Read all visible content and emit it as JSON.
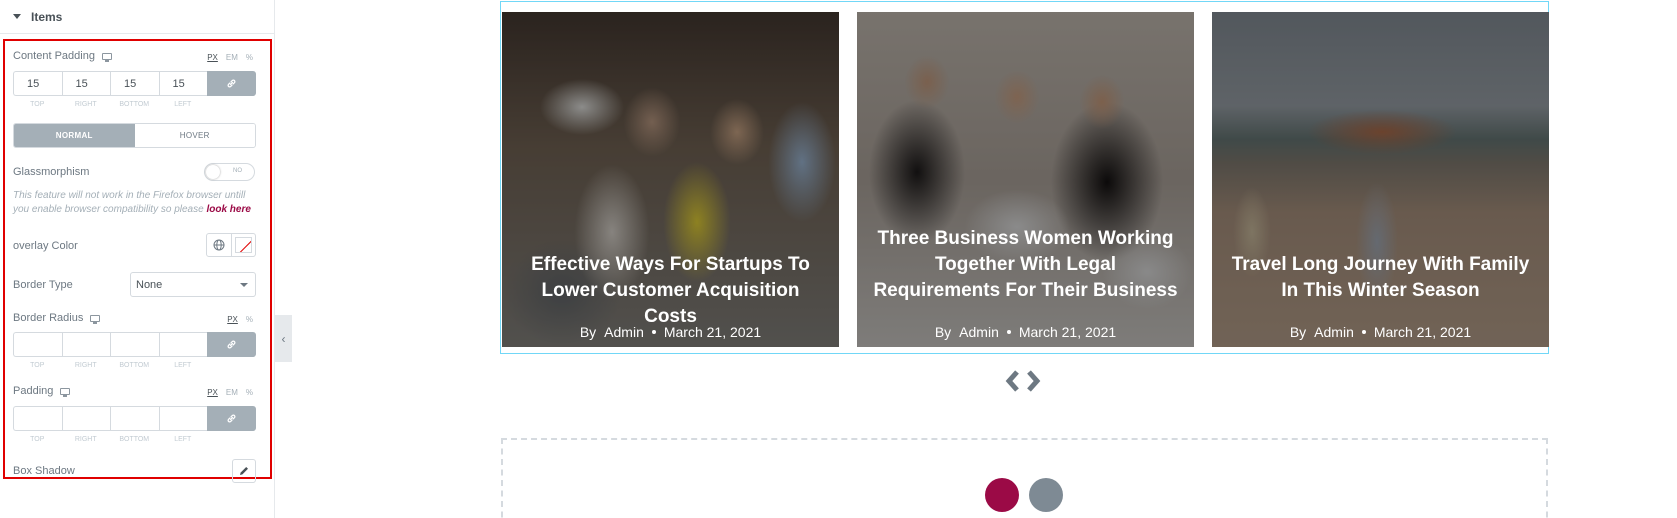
{
  "panel": {
    "section_title": "Items",
    "content_padding": {
      "label": "Content Padding",
      "units": [
        "PX",
        "EM",
        "%"
      ],
      "values": [
        "15",
        "15",
        "15",
        "15"
      ],
      "sides": [
        "TOP",
        "RIGHT",
        "BOTTOM",
        "LEFT"
      ]
    },
    "tabs": [
      "NORMAL",
      "HOVER"
    ],
    "glassmorphism": {
      "label": "Glassmorphism",
      "toggle_text": "NO"
    },
    "note": {
      "text": "This feature will not work in the Firefox browser untill you enable browser compatibility so please",
      "link": "look here"
    },
    "overlay_color": {
      "label": "overlay Color"
    },
    "border_type": {
      "label": "Border Type",
      "value": "None"
    },
    "border_radius": {
      "label": "Border Radius",
      "units": [
        "PX",
        "%"
      ],
      "sides": [
        "TOP",
        "RIGHT",
        "BOTTOM",
        "LEFT"
      ]
    },
    "padding": {
      "label": "Padding",
      "units": [
        "PX",
        "EM",
        "%"
      ],
      "sides": [
        "TOP",
        "RIGHT",
        "BOTTOM",
        "LEFT"
      ]
    },
    "box_shadow": {
      "label": "Box Shadow"
    }
  },
  "cards": [
    {
      "title": "Effective Ways For Startups To Lower Customer Acquisition Costs",
      "by": "By",
      "author": "Admin",
      "date": "March 21, 2021"
    },
    {
      "title": "Three Business Women Working Together With Legal Requirements For Their Business",
      "by": "By",
      "author": "Admin",
      "date": "March 21, 2021"
    },
    {
      "title": "Travel Long Journey With Family In This Winter Season",
      "by": "By",
      "author": "Admin",
      "date": "March 21, 2021"
    }
  ],
  "colors": {
    "accent": "#9b0a46",
    "highlight_border": "#e00000",
    "carousel_border": "#71d7f7",
    "link_button": "#a4afb7"
  }
}
